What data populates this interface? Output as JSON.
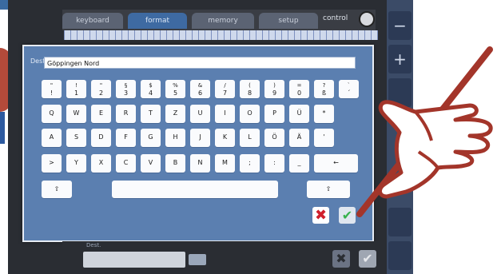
{
  "tabs": [
    {
      "label": "keyboard"
    },
    {
      "label": "format"
    },
    {
      "label": "memory"
    },
    {
      "label": "setup"
    }
  ],
  "control_label": "control",
  "destination": {
    "label": "Dest.",
    "value": "Göppingen Nord"
  },
  "keyboard": {
    "row1": [
      {
        "top": "\"",
        "bot": "!"
      },
      {
        "top": "!",
        "bot": "1"
      },
      {
        "top": "\"",
        "bot": "2"
      },
      {
        "top": "§",
        "bot": "3"
      },
      {
        "top": "$",
        "bot": "4"
      },
      {
        "top": "%",
        "bot": "5"
      },
      {
        "top": "&",
        "bot": "6"
      },
      {
        "top": "/",
        "bot": "7"
      },
      {
        "top": "(",
        "bot": "8"
      },
      {
        "top": ")",
        "bot": "9"
      },
      {
        "top": "=",
        "bot": "0"
      },
      {
        "top": "?",
        "bot": "ß"
      },
      {
        "top": "`",
        "bot": "´"
      }
    ],
    "row2": [
      "Q",
      "W",
      "E",
      "R",
      "T",
      "Z",
      "U",
      "I",
      "O",
      "P",
      "Ü",
      "*"
    ],
    "row3": [
      "A",
      "S",
      "D",
      "F",
      "G",
      "H",
      "J",
      "K",
      "L",
      "Ö",
      "Ä",
      "'"
    ],
    "row4": [
      ">",
      "Y",
      "X",
      "C",
      "V",
      "B",
      "N",
      "M",
      ";",
      ":",
      "_",
      "←"
    ],
    "shift_label": "⇧",
    "space_label": ""
  },
  "actions": {
    "cancel_label": "✖",
    "ok_label": "✔"
  },
  "lower": {
    "field_label": "Dest."
  },
  "right_bar": {
    "minus_label": "−",
    "plus_label": "+"
  },
  "colors": {
    "panel": "#5b7fb0",
    "cancel": "#d0202c",
    "ok": "#37b24d",
    "pen": "#a3352a"
  }
}
